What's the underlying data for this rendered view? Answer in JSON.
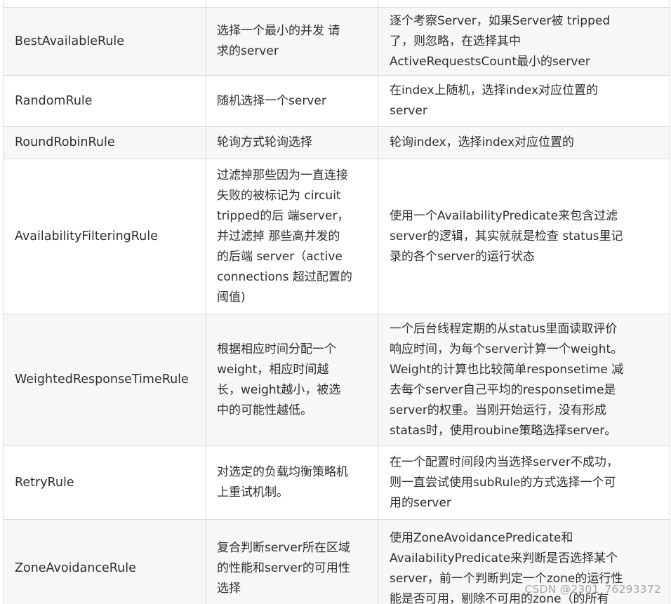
{
  "table": {
    "rows": [
      {
        "rule": "",
        "description": [],
        "implementation": []
      },
      {
        "rule": "BestAvailableRule",
        "description": [
          "选择一个最小的并发 请",
          "求的server"
        ],
        "implementation": [
          "逐个考察Server，如果Server被 tripped",
          "了，则忽略，在选择其中",
          "ActiveRequestsCount最小的server"
        ]
      },
      {
        "rule": "RandomRule",
        "description": [
          "随机选择一个server"
        ],
        "implementation": [
          "在index上随机，选择index对应位置的",
          "server"
        ]
      },
      {
        "rule": "RoundRobinRule",
        "description": [
          "轮询方式轮询选择"
        ],
        "implementation": [
          "轮询index，选择index对应位置的"
        ]
      },
      {
        "rule": "AvailabilityFilteringRule",
        "description": [
          "过滤掉那些因为一直连接",
          "失败的被标记为 circuit",
          "tripped的后 端server，",
          "并过滤掉 那些高并发的",
          "的后端 server（active",
          "connections 超过配置的",
          "阈值)"
        ],
        "implementation": [
          "使用一个AvailabilityPredicate来包含过滤",
          "server的逻辑，其实就就是检查 status里记",
          "录的各个server的运行状态"
        ]
      },
      {
        "rule": "WeightedResponseTimeRule",
        "description": [
          "根据相应时间分配一个",
          "weight，相应时间越",
          "长，weight越小，被选",
          "中的可能性越低。"
        ],
        "implementation": [
          "一个后台线程定期的从status里面读取评价",
          "响应时间，为每个server计算一个weight。",
          "Weight的计算也比较简单responsetime 减",
          "去每个server自己平均的responsetime是",
          "server的权重。当刚开始运行，没有形成",
          "statas时，使用roubine策略选择server。"
        ]
      },
      {
        "rule": "RetryRule",
        "description": [
          "对选定的负载均衡策略机",
          "上重试机制。"
        ],
        "implementation": [
          "在一个配置时间段内当选择server不成功，",
          "则一直尝试使用subRule的方式选择一个可",
          "用的server"
        ]
      },
      {
        "rule": "ZoneAvoidanceRule",
        "description": [
          "复合判断server所在区域",
          "的性能和server的可用性",
          "选择"
        ],
        "implementation": [
          "使用ZoneAvoidancePredicate和",
          "AvailabilityPredicate来判断是否选择某个",
          "server，前一个判断判定一个zone的运行性",
          "能是否可用，剔除不可用的zone（的所有"
        ]
      }
    ]
  },
  "watermark": "CSDN @2301_76293372"
}
